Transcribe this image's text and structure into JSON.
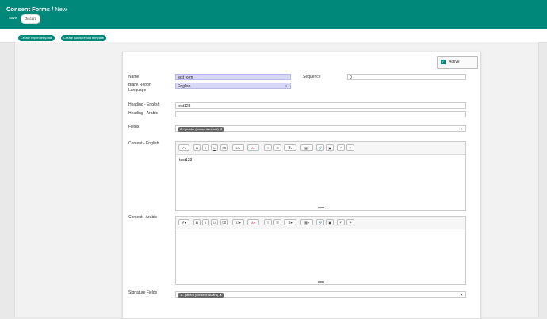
{
  "header": {
    "breadcrumb_root": "Consent Forms",
    "breadcrumb_sep": "/",
    "breadcrumb_current": "New",
    "save_label": "Save",
    "discard_label": "Discard"
  },
  "actions": {
    "create_report_template": "Create report template",
    "create_blank_report_template": "Create Blank report template"
  },
  "form": {
    "active_label": "Active",
    "name_label": "Name",
    "name_value": "test form",
    "sequence_label": "Sequence",
    "sequence_value": "0",
    "blank_lang_label_1": "Blank Report",
    "blank_lang_label_2": "Language",
    "blank_lang_value": "English",
    "heading_en_label": "Heading - English",
    "heading_en_value": "test123",
    "heading_ar_label": "Heading - Arabic",
    "heading_ar_value": "",
    "fields_label": "Fields",
    "fields_tag": "2 - gender (consent.wizard)",
    "content_en_label": "Content - English",
    "content_en_value": "test123",
    "content_ar_label": "Content - Arabic",
    "content_ar_value": "",
    "signature_label": "Signature Fields",
    "signature_tag": "1 - patient (consent.wizard)"
  },
  "editor_toolbar": {
    "style": "✐▾",
    "bold": "B",
    "italic": "I",
    "underline": "U",
    "eraser": "⌫",
    "font_size": "13▾",
    "color": "A▾",
    "bullet_list": "≡",
    "ordered_list": "☰",
    "paragraph": "≣▾",
    "table": "▦▾",
    "link": "🔗",
    "image": "▣",
    "undo": "↶",
    "redo": "↷"
  },
  "colors": {
    "brand": "#00897b",
    "required_bg": "#d7d7f6"
  }
}
